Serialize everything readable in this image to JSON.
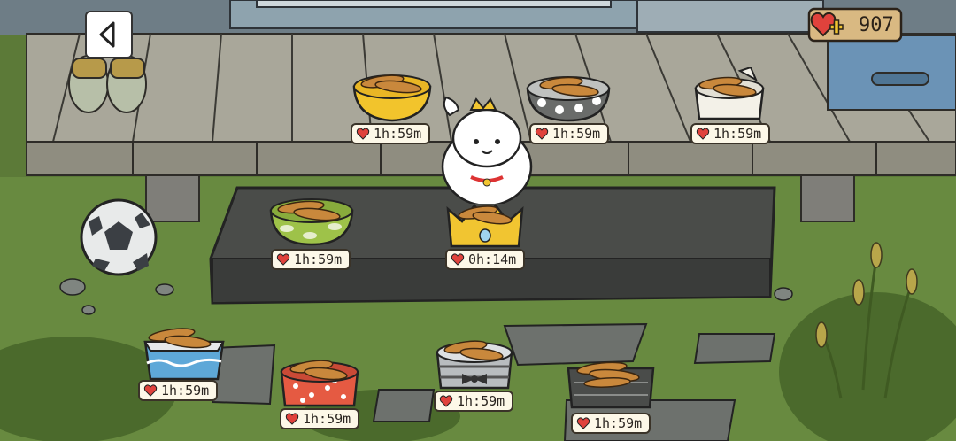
{
  "hud": {
    "hearts": "907",
    "back_icon": "chevron-left-icon"
  },
  "bowls": [
    {
      "id": "yellow-bowl",
      "timer": "1h:59m"
    },
    {
      "id": "dotted-gray-bowl",
      "timer": "1h:59m"
    },
    {
      "id": "cat-ear-bowl",
      "timer": "1h:59m"
    },
    {
      "id": "green-bowl",
      "timer": "1h:59m"
    },
    {
      "id": "gold-crown-bowl",
      "timer": "0h:14m"
    },
    {
      "id": "blue-box-bowl",
      "timer": "1h:59m"
    },
    {
      "id": "red-polka-bowl",
      "timer": "1h:59m"
    },
    {
      "id": "bowtie-bowl",
      "timer": "1h:59m"
    },
    {
      "id": "gray-box-bowl",
      "timer": "1h:59m"
    }
  ],
  "colors": {
    "porch_wood": "#a9a79a",
    "grass": "#5c7a38",
    "stone_slab": "#4a4c49",
    "timer_bg": "#fdf8e8",
    "heart_red": "#e0423c"
  }
}
